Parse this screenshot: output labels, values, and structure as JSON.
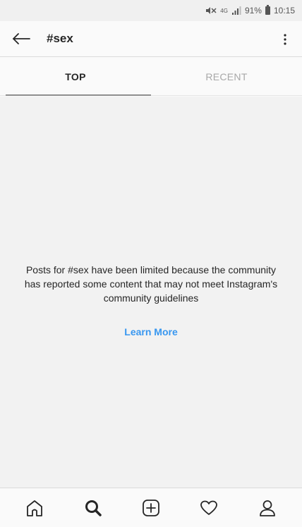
{
  "status_bar": {
    "network": "4G",
    "battery_percent": "91%",
    "time": "10:15"
  },
  "header": {
    "title": "#sex"
  },
  "tabs": [
    {
      "label": "TOP",
      "active": true
    },
    {
      "label": "RECENT",
      "active": false
    }
  ],
  "content": {
    "message": "Posts for #sex have been limited because the community has reported some content that may not meet Instagram's community guidelines",
    "learn_more_label": "Learn More"
  },
  "bottom_nav": {
    "items": [
      "home-icon",
      "search-icon",
      "add-post-icon",
      "heart-icon",
      "profile-icon"
    ]
  },
  "colors": {
    "link_blue": "#3897f0",
    "text_dark": "#262626",
    "tab_inactive": "#a8a8a8"
  }
}
